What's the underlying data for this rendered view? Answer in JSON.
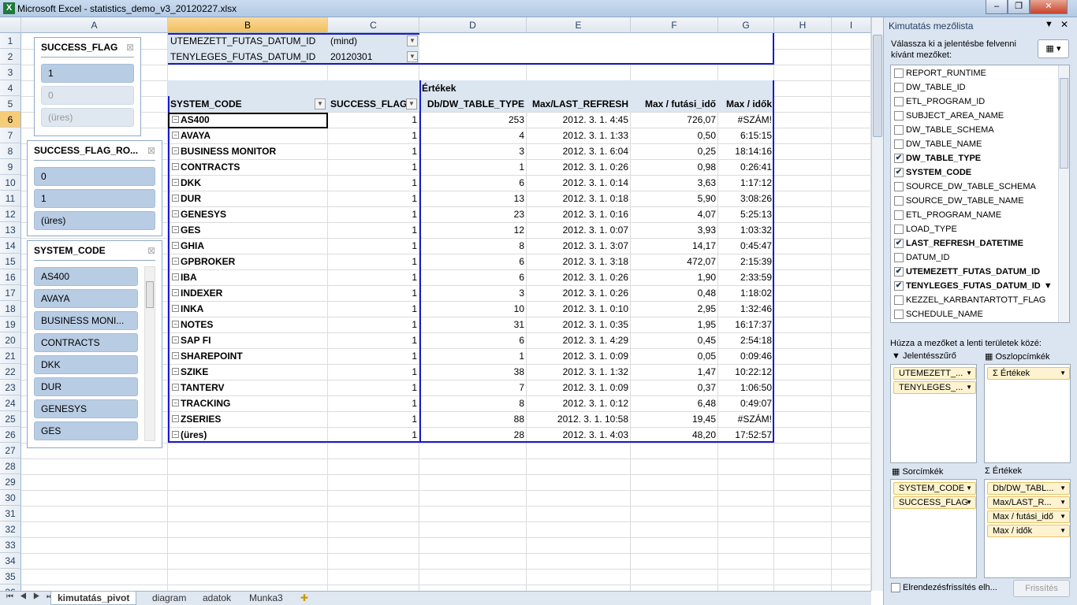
{
  "window": {
    "title": "Microsoft Excel - statistics_demo_v3_20120227.xlsx",
    "minimize": "–",
    "restore": "❐",
    "close": "✕"
  },
  "columns": [
    "A",
    "B",
    "C",
    "D",
    "E",
    "F",
    "G",
    "H",
    "I"
  ],
  "rows": [
    "1",
    "2",
    "3",
    "4",
    "5",
    "6",
    "7",
    "8",
    "9",
    "10",
    "11",
    "12",
    "13",
    "14",
    "15",
    "16",
    "17",
    "18",
    "19",
    "20",
    "21",
    "22",
    "23",
    "24",
    "25",
    "26",
    "27",
    "28",
    "29",
    "30",
    "31",
    "32",
    "33",
    "34",
    "35",
    "36"
  ],
  "report_filters": [
    {
      "field": "UTEMEZETT_FUTAS_DATUM_ID",
      "value": "(mind)",
      "filtered": false
    },
    {
      "field": "TENYLEGES_FUTAS_DATUM_ID",
      "value": "20120301",
      "filtered": true
    }
  ],
  "pivot": {
    "values_caption": "Értékek",
    "headers": [
      "SYSTEM_CODE",
      "SUCCESS_FLAG",
      "Db/DW_TABLE_TYPE",
      "Max/LAST_REFRESH",
      "Max / futási_idő",
      "Max / idők"
    ],
    "rows": [
      [
        "AS400",
        "1",
        "253",
        "2012. 3. 1. 4:45",
        "726,07",
        "#SZÁM!"
      ],
      [
        "AVAYA",
        "1",
        "4",
        "2012. 3. 1. 1:33",
        "0,50",
        "6:15:15"
      ],
      [
        "BUSINESS MONITOR",
        "1",
        "3",
        "2012. 3. 1. 6:04",
        "0,25",
        "18:14:16"
      ],
      [
        "CONTRACTS",
        "1",
        "1",
        "2012. 3. 1. 0:26",
        "0,98",
        "0:26:41"
      ],
      [
        "DKK",
        "1",
        "6",
        "2012. 3. 1. 0:14",
        "3,63",
        "1:17:12"
      ],
      [
        "DUR",
        "1",
        "13",
        "2012. 3. 1. 0:18",
        "5,90",
        "3:08:26"
      ],
      [
        "GENESYS",
        "1",
        "23",
        "2012. 3. 1. 0:16",
        "4,07",
        "5:25:13"
      ],
      [
        "GES",
        "1",
        "12",
        "2012. 3. 1. 0:07",
        "3,93",
        "1:03:32"
      ],
      [
        "GHIA",
        "1",
        "8",
        "2012. 3. 1. 3:07",
        "14,17",
        "0:45:47"
      ],
      [
        "GPBROKER",
        "1",
        "6",
        "2012. 3. 1. 3:18",
        "472,07",
        "2:15:39"
      ],
      [
        "IBA",
        "1",
        "6",
        "2012. 3. 1. 0:26",
        "1,90",
        "2:33:59"
      ],
      [
        "INDEXER",
        "1",
        "3",
        "2012. 3. 1. 0:26",
        "0,48",
        "1:18:02"
      ],
      [
        "INKA",
        "1",
        "10",
        "2012. 3. 1. 0:10",
        "2,95",
        "1:32:46"
      ],
      [
        "NOTES",
        "1",
        "31",
        "2012. 3. 1. 0:35",
        "1,95",
        "16:17:37"
      ],
      [
        "SAP FI",
        "1",
        "6",
        "2012. 3. 1. 4:29",
        "0,45",
        "2:54:18"
      ],
      [
        "SHAREPOINT",
        "1",
        "1",
        "2012. 3. 1. 0:09",
        "0,05",
        "0:09:46"
      ],
      [
        "SZIKE",
        "1",
        "38",
        "2012. 3. 1. 1:32",
        "1,47",
        "10:22:12"
      ],
      [
        "TANTERV",
        "1",
        "7",
        "2012. 3. 1. 0:09",
        "0,37",
        "1:06:50"
      ],
      [
        "TRACKING",
        "1",
        "8",
        "2012. 3. 1. 0:12",
        "6,48",
        "0:49:07"
      ],
      [
        "ZSERIES",
        "1",
        "88",
        "2012. 3. 1. 10:58",
        "19,45",
        "#SZÁM!"
      ],
      [
        "(üres)",
        "1",
        "28",
        "2012. 3. 1. 4:03",
        "48,20",
        "17:52:57"
      ]
    ]
  },
  "slicers": [
    {
      "title": "SUCCESS_FLAG",
      "items": [
        {
          "label": "1",
          "selected": true
        },
        {
          "label": "0",
          "selected": false
        },
        {
          "label": "(üres)",
          "selected": false
        }
      ]
    },
    {
      "title": "SUCCESS_FLAG_RO...",
      "items": [
        {
          "label": "0",
          "selected": true
        },
        {
          "label": "1",
          "selected": true
        },
        {
          "label": "(üres)",
          "selected": true
        }
      ]
    },
    {
      "title": "SYSTEM_CODE",
      "items": [
        {
          "label": "AS400"
        },
        {
          "label": "AVAYA"
        },
        {
          "label": "BUSINESS MONI..."
        },
        {
          "label": "CONTRACTS"
        },
        {
          "label": "DKK"
        },
        {
          "label": "DUR"
        },
        {
          "label": "GENESYS"
        },
        {
          "label": "GES"
        }
      ]
    }
  ],
  "sheet_tabs": [
    "kimutatás_pivot",
    "diagram",
    "adatok",
    "Munka3"
  ],
  "pane": {
    "title": "Kimutatás mezőlista",
    "instruction": "Válassza ki a jelentésbe felvenni kívánt mezőket:",
    "fields": [
      {
        "name": "REPORT_RUNTIME",
        "checked": false
      },
      {
        "name": "DW_TABLE_ID",
        "checked": false
      },
      {
        "name": "ETL_PROGRAM_ID",
        "checked": false
      },
      {
        "name": "SUBJECT_AREA_NAME",
        "checked": false
      },
      {
        "name": "DW_TABLE_SCHEMA",
        "checked": false
      },
      {
        "name": "DW_TABLE_NAME",
        "checked": false
      },
      {
        "name": "DW_TABLE_TYPE",
        "checked": true
      },
      {
        "name": "SYSTEM_CODE",
        "checked": true
      },
      {
        "name": "SOURCE_DW_TABLE_SCHEMA",
        "checked": false
      },
      {
        "name": "SOURCE_DW_TABLE_NAME",
        "checked": false
      },
      {
        "name": "ETL_PROGRAM_NAME",
        "checked": false
      },
      {
        "name": "LOAD_TYPE",
        "checked": false
      },
      {
        "name": "LAST_REFRESH_DATETIME",
        "checked": true
      },
      {
        "name": "DATUM_ID",
        "checked": false
      },
      {
        "name": "UTEMEZETT_FUTAS_DATUM_ID",
        "checked": true
      },
      {
        "name": "TENYLEGES_FUTAS_DATUM_ID",
        "checked": true,
        "filtered": true
      },
      {
        "name": "KEZZEL_KARBANTARTOTT_FLAG",
        "checked": false
      },
      {
        "name": "SCHEDULE_NAME",
        "checked": false
      }
    ],
    "drag_hint": "Húzza a mezőket a lenti területek közé:",
    "report_filter_label": "Jelentésszűrő",
    "column_labels_label": "Oszlopcímkék",
    "row_labels_label": "Sorcímkék",
    "values_label": "Értékek",
    "report_filter_items": [
      "UTEMEZETT_...",
      "TENYLEGES_..."
    ],
    "column_items": [
      "Σ Értékek"
    ],
    "row_items": [
      "SYSTEM_CODE",
      "SUCCESS_FLAG"
    ],
    "value_items": [
      "Db/DW_TABL...",
      "Max/LAST_R...",
      "Max / futási_idő",
      "Max / idők"
    ],
    "defer_label": "Elrendezésfrissítés elh...",
    "update_button": "Frissítés"
  }
}
